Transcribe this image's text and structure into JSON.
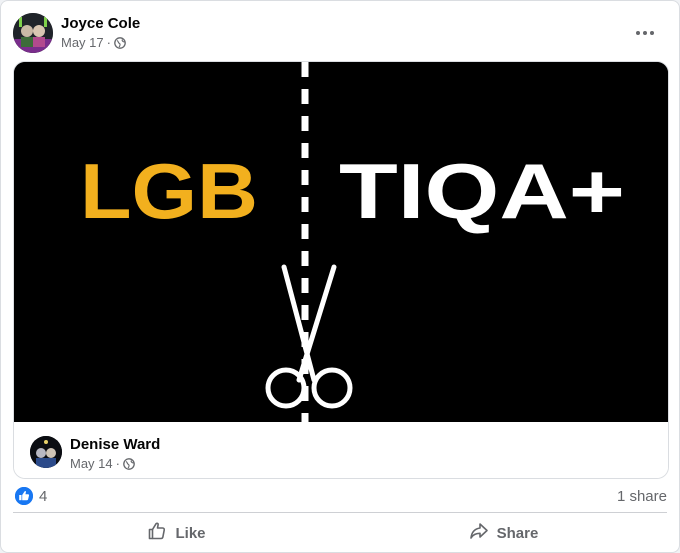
{
  "post": {
    "author": "Joyce Cole",
    "date": "May 17",
    "separator": "·",
    "privacy_icon": "globe-icon"
  },
  "shared_post": {
    "image": {
      "left_text": "LGB",
      "right_text": "TIQA+",
      "left_color": "#f2b01e",
      "right_color": "#ffffff",
      "icons": [
        "scissors-icon",
        "dashed-cut-line"
      ]
    },
    "author": "Denise Ward",
    "date": "May 14",
    "separator": "·",
    "privacy_icon": "globe-icon"
  },
  "stats": {
    "reaction_count": "4",
    "shares": "1 share"
  },
  "actions": {
    "like_label": "Like",
    "share_label": "Share"
  },
  "colors": {
    "accent": "#1877f2",
    "secondary_text": "#65676b"
  }
}
